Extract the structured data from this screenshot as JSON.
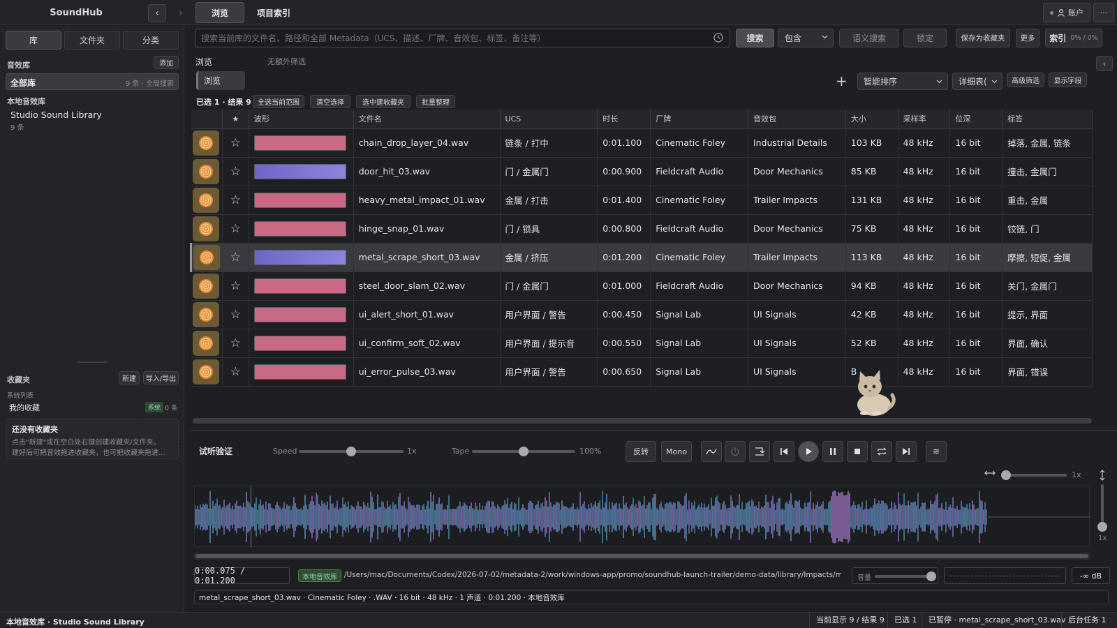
{
  "app": {
    "title": "SoundHub"
  },
  "top_tabs": [
    {
      "label": "浏览"
    },
    {
      "label": "项目索引"
    }
  ],
  "account": {
    "label": "账户"
  },
  "sidebar": {
    "tabs": [
      "库",
      "文件夹",
      "分类"
    ],
    "library_section": "音效库",
    "add_label": "添加",
    "all_library": {
      "label": "全部库",
      "meta": "9 条 · 全局搜索"
    },
    "local_section": "本地音效库",
    "local_item": {
      "name": "Studio Sound Library",
      "count": "9 条"
    },
    "favorites_section": "收藏夹",
    "new_label": "新建",
    "import_export_label": "导入/导出",
    "system_list": "系统列表",
    "my_favorites": {
      "label": "我的收藏",
      "badge": "系统",
      "count": "0 条"
    },
    "empty": {
      "title": "还没有收藏夹",
      "line1": "点击\"新建\"或在空白处右键创建收藏夹/文件夹。",
      "line2": "建好后可把音效拖进收藏夹，也可把收藏夹拖进..."
    }
  },
  "search": {
    "placeholder": "搜索当前库的文件名、路径和全部 Metadata（UCS、描述、厂牌、音效包、标签、备注等）",
    "search_button": "搜索",
    "mode": "包含",
    "semantic": "语义搜索",
    "lock": "锁定",
    "save_as_fav": "保存为收藏夹",
    "more": "更多",
    "index_label": "索引",
    "index_progress": "0% / 0%"
  },
  "browse": {
    "title": "浏览",
    "filter_note": "无额外筛选",
    "tab": "浏览",
    "add": "+",
    "sort": "智能排序",
    "view": "详细表(",
    "advanced": "高级筛选",
    "fields": "显示字段",
    "selection_summary": "已选 1 · 结果 9",
    "actions": [
      "全选当前范围",
      "清空选择",
      "选中建收藏夹",
      "批量整理"
    ]
  },
  "table": {
    "columns": [
      "★",
      "波形",
      "文件名",
      "UCS",
      "时长",
      "厂牌",
      "音效包",
      "大小",
      "采样率",
      "位深",
      "标签"
    ],
    "rows": [
      {
        "file": "chain_drop_layer_04.wav",
        "ucs": "链条 / 打中",
        "dur": "0:01.100",
        "label": "Cinematic Foley",
        "pack": "Industrial Details",
        "size": "103 KB",
        "rate": "48 kHz",
        "bits": "16 bit",
        "tags": "掉落, 金属, 链条"
      },
      {
        "file": "door_hit_03.wav",
        "ucs": "门 / 金属门",
        "dur": "0:00.900",
        "label": "Fieldcraft Audio",
        "pack": "Door Mechanics",
        "size": "85 KB",
        "rate": "48 kHz",
        "bits": "16 bit",
        "tags": "撞击, 金属门"
      },
      {
        "file": "heavy_metal_impact_01.wav",
        "ucs": "金属 / 打击",
        "dur": "0:01.400",
        "label": "Cinematic Foley",
        "pack": "Trailer Impacts",
        "size": "131 KB",
        "rate": "48 kHz",
        "bits": "16 bit",
        "tags": "重击, 金属"
      },
      {
        "file": "hinge_snap_01.wav",
        "ucs": "门 / 锁具",
        "dur": "0:00.800",
        "label": "Fieldcraft Audio",
        "pack": "Door Mechanics",
        "size": "75 KB",
        "rate": "48 kHz",
        "bits": "16 bit",
        "tags": "铰链, 门"
      },
      {
        "file": "metal_scrape_short_03.wav",
        "ucs": "金属 / 挤压",
        "dur": "0:01.200",
        "label": "Cinematic Foley",
        "pack": "Trailer Impacts",
        "size": "113 KB",
        "rate": "48 kHz",
        "bits": "16 bit",
        "tags": "摩擦, 短促, 金属"
      },
      {
        "file": "steel_door_slam_02.wav",
        "ucs": "门 / 金属门",
        "dur": "0:01.000",
        "label": "Fieldcraft Audio",
        "pack": "Door Mechanics",
        "size": "94 KB",
        "rate": "48 kHz",
        "bits": "16 bit",
        "tags": "关门, 金属门"
      },
      {
        "file": "ui_alert_short_01.wav",
        "ucs": "用户界面 / 警告",
        "dur": "0:00.450",
        "label": "Signal Lab",
        "pack": "UI Signals",
        "size": "42 KB",
        "rate": "48 kHz",
        "bits": "16 bit",
        "tags": "提示, 界面"
      },
      {
        "file": "ui_confirm_soft_02.wav",
        "ucs": "用户界面 / 提示音",
        "dur": "0:00.550",
        "label": "Signal Lab",
        "pack": "UI Signals",
        "size": "52 KB",
        "rate": "48 kHz",
        "bits": "16 bit",
        "tags": "界面, 确认"
      },
      {
        "file": "ui_error_pulse_03.wav",
        "ucs": "用户界面 / 警告",
        "dur": "0:00.650",
        "label": "Signal Lab",
        "pack": "UI Signals",
        "size": "B",
        "rate": "48 kHz",
        "bits": "16 bit",
        "tags": "界面, 错误"
      }
    ]
  },
  "player": {
    "title": "试听验证",
    "speed_label": "Speed",
    "speed_value": "1x",
    "speed_level": 0.5,
    "tape_label": "Tape",
    "tape_value": "100%",
    "tape_level": 0.5,
    "reverse": "反转",
    "mono": "Mono",
    "zoom_value": "1x",
    "vzoom_value": "1x",
    "time": "0:00.075 / 0:01.200",
    "source_badge": "本地音效库",
    "path": "/Users/mac/Documents/Codex/2026-07-02/metadata-2/work/windows-app/promo/soundhub-launch-trailer/demo-data/library/Impacts/met...",
    "volume_label": "音量",
    "db": "-∞ dB",
    "file_info": "metal_scrape_short_03.wav · Cinematic Foley · .WAV · 16 bit · 48 kHz · 1 声道 · 0:01.200 · 本地音效库"
  },
  "status": {
    "left": "本地音效库 · Studio Sound Library",
    "display": "当前显示 9 / 结果 9",
    "selected": "已选 1",
    "paused": "已暂停 · metal_scrape_short_03.wav",
    "tasks": "后台任务 1"
  }
}
